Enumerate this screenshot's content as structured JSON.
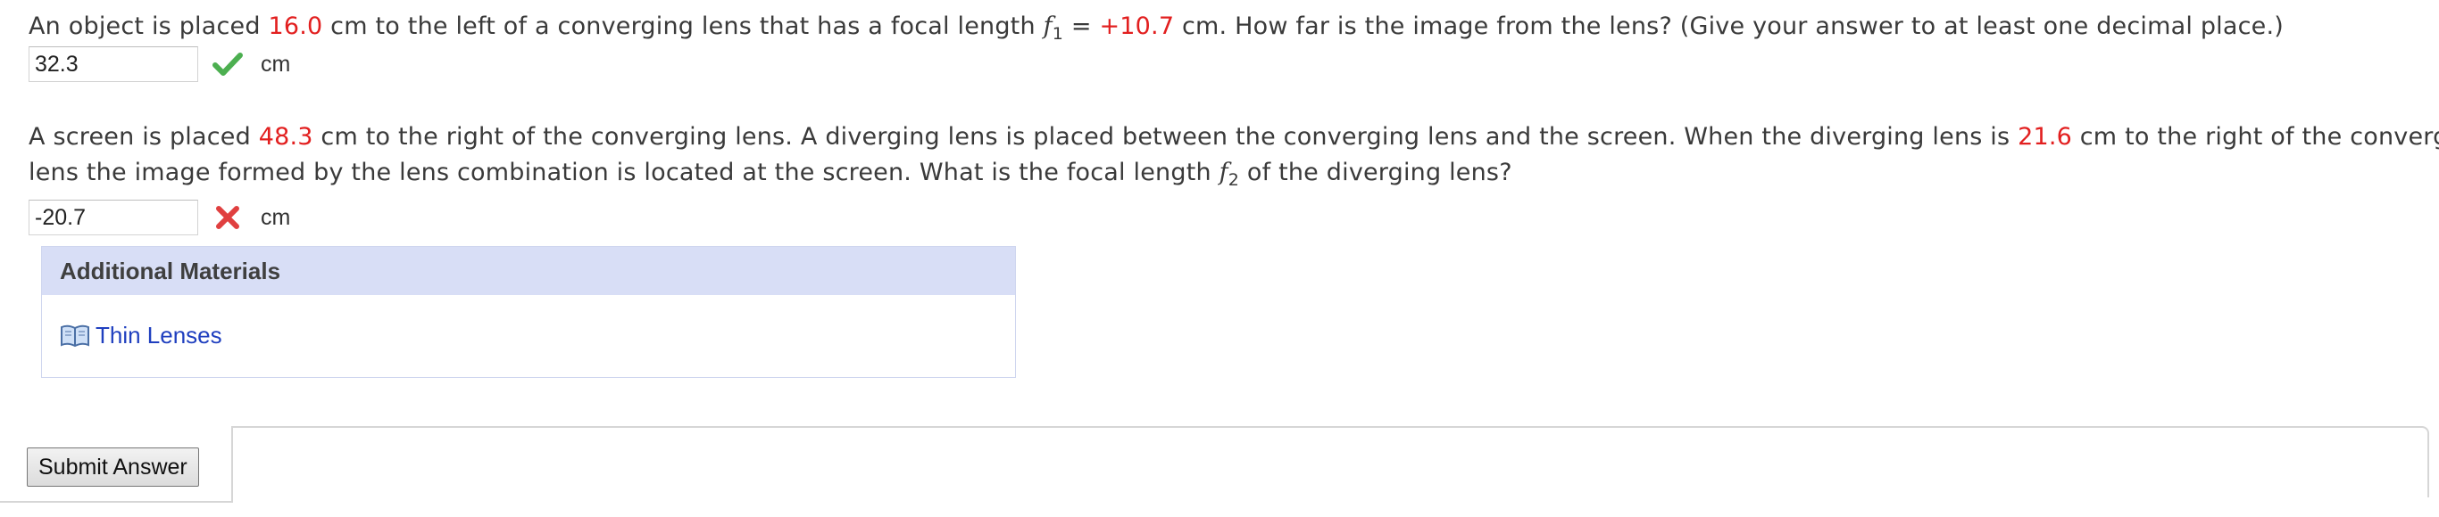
{
  "q1": {
    "text_before": "An object is placed ",
    "distance": "16.0",
    "text_mid": " cm to the left of a converging lens that has a focal length ",
    "f_symbol": "f",
    "f_sub": "1",
    "equals": " = ",
    "focal": "+10.7",
    "text_after": " cm.  How far is the image from the lens? (Give your answer to at least one decimal place.)",
    "answer_value": "32.3",
    "unit": "cm",
    "status": "correct"
  },
  "q2": {
    "line1_before": "A screen is placed ",
    "screen_distance": "48.3",
    "line1_mid": " cm to the right of the converging lens. A diverging lens is placed between the converging lens and the screen. When the diverging lens is ",
    "diverging_distance": "21.6",
    "line1_after": " cm to the right of the converging",
    "line2_before": "lens the image formed by the lens combination is located at the screen. What is the focal length ",
    "f_symbol": "f",
    "f_sub": "2",
    "line2_after": " of the diverging lens?",
    "answer_value": "-20.7",
    "unit": "cm",
    "status": "incorrect"
  },
  "additional": {
    "title": "Additional Materials",
    "link_label": "Thin Lenses",
    "icon": "book-icon"
  },
  "submit_label": "Submit Answer",
  "colors": {
    "highlight": "#e21f1f",
    "correct": "#4caf50",
    "incorrect": "#e04040",
    "panel_header": "#d8def6",
    "link": "#1f3fbf"
  }
}
